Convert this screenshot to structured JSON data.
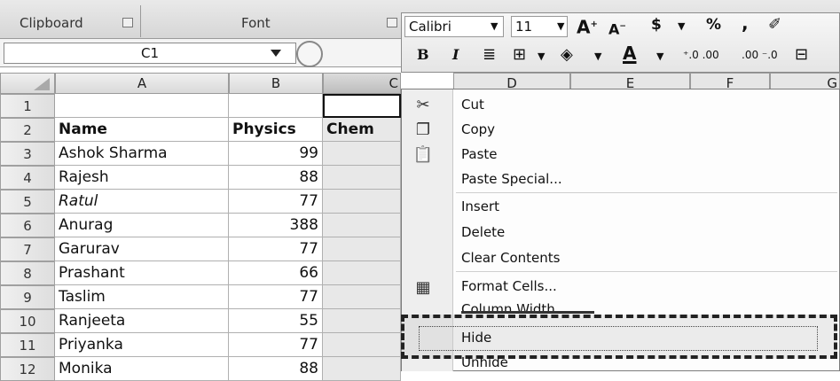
{
  "ribbon": {
    "clipboard_label": "Clipboard",
    "font_label": "Font"
  },
  "name_box": {
    "value": "C1"
  },
  "columns": [
    "A",
    "B",
    "C",
    "D",
    "E",
    "F",
    "G"
  ],
  "rows": [
    {
      "num": "1",
      "name": "",
      "physics": "",
      "chem": ""
    },
    {
      "num": "2",
      "name": "Name",
      "physics": "Physics",
      "chem": "Chem"
    },
    {
      "num": "3",
      "name": "Ashok Sharma",
      "physics": "99"
    },
    {
      "num": "4",
      "name": "Rajesh",
      "physics": "88"
    },
    {
      "num": "5",
      "name": "Ratul",
      "physics": "77"
    },
    {
      "num": "6",
      "name": "Anurag",
      "physics": "388"
    },
    {
      "num": "7",
      "name": "Garurav",
      "physics": "77"
    },
    {
      "num": "8",
      "name": "Prashant",
      "physics": "66"
    },
    {
      "num": "9",
      "name": "Taslim",
      "physics": "77"
    },
    {
      "num": "10",
      "name": "Ranjeeta",
      "physics": "55"
    },
    {
      "num": "11",
      "name": "Priyanka",
      "physics": "77"
    },
    {
      "num": "12",
      "name": "Monika",
      "physics": "88"
    }
  ],
  "mini_toolbar": {
    "font_name": "Calibri",
    "font_size": "11",
    "currency": "$",
    "percent": "%",
    "comma": ",",
    "bold": "B",
    "italic": "I",
    "font_color": "A"
  },
  "context_menu": {
    "items": [
      "Cut",
      "Copy",
      "Paste",
      "Paste Special...",
      "Insert",
      "Delete",
      "Clear Contents",
      "Format Cells...",
      "Column Width...",
      "Hide",
      "Unhide"
    ]
  },
  "icons": {
    "cut": "scissors-icon",
    "copy": "copy-icon",
    "paste": "paste-icon",
    "format_cells": "format-cells-icon"
  }
}
